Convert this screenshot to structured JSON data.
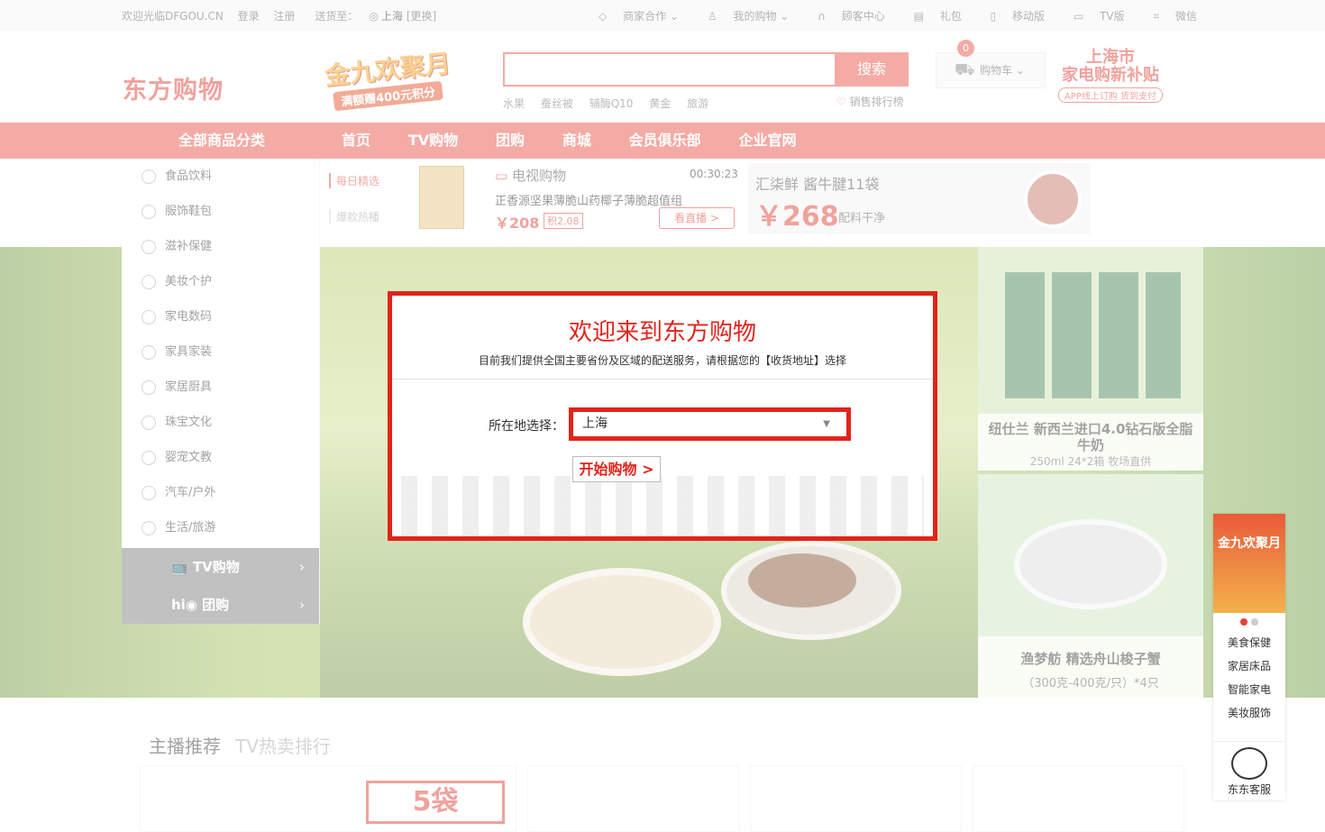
{
  "topbar": {
    "welcome": "欢迎光临DFGOU.CN",
    "login": "登录",
    "register": "注册",
    "ship_to_label": "送货至：",
    "ship_to_city": "上海",
    "change": "[更换]",
    "right": [
      "商家合作",
      "我的购物",
      "顾客中心",
      "礼包",
      "移动版",
      "TV版",
      "微信"
    ]
  },
  "header": {
    "logo": "东方购物",
    "promo_title": "金九欢聚月",
    "promo_sub": "满额赠400元积分",
    "search_button": "搜索",
    "search_placeholder": "",
    "hot_words": [
      "水果",
      "蚕丝被",
      "辅酶Q10",
      "黄金",
      "旅游"
    ],
    "rank": "销售排行榜",
    "cart_label": "购物车",
    "cart_count": "0",
    "subsidy_line1": "上海市",
    "subsidy_line2": "家电购新补贴",
    "subsidy_line3": "APP线上订购 货到支付"
  },
  "nav": {
    "all_categories": "全部商品分类",
    "items": [
      "首页",
      "TV购物",
      "团购",
      "商城",
      "会员俱乐部",
      "企业官网"
    ]
  },
  "categories": [
    "食品饮料",
    "服饰鞋包",
    "滋补保健",
    "美妆个护",
    "家电数码",
    "家具家装",
    "家居厨具",
    "珠宝文化",
    "婴宠文教",
    "汽车/户外",
    "生活/旅游"
  ],
  "cat_tv": "TV购物",
  "cat_group": "团购",
  "daily": {
    "tab1": "每日精选",
    "tab2": "爆款热播",
    "tv_title": "电视购物",
    "time": "00:30:23",
    "product": "正香源坚果薄脆山药椰子薄脆超值组",
    "price": "￥208",
    "points": "积2.08",
    "watch": "看直播 >"
  },
  "ad": {
    "name": "汇柒鲜 酱牛腱11袋",
    "price": "￥268",
    "desc": "配料干净"
  },
  "right_products": [
    {
      "name": "纽仕兰 新西兰进口4.0钻石版全脂牛奶",
      "desc": "250ml 24*2箱 牧场直供"
    },
    {
      "name": "渔梦舫 精选舟山梭子蟹",
      "desc": "（300克-400克/只）*4只"
    }
  ],
  "side": {
    "promo": "金九欢聚月",
    "items": [
      "美食保健",
      "家居床品",
      "智能家电",
      "美妆服饰"
    ],
    "service": "东东客服"
  },
  "section": {
    "tab1": "主播推荐",
    "tab2": "TV热卖排行",
    "badge": "5袋"
  },
  "modal": {
    "title": "欢迎来到东方购物",
    "subtitle": "目前我们提供全国主要省份及区域的配送服务，请根据您的【收货地址】选择",
    "location_label": "所在地选择：",
    "location_value": "上海",
    "start_button": "开始购物 >"
  },
  "colors": {
    "brand": "#e8564b",
    "modal_border": "#e2231a"
  }
}
